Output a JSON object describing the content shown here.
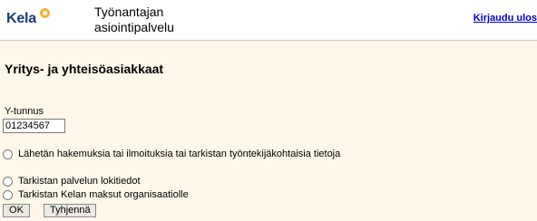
{
  "header": {
    "logo_text": "Kela",
    "service_line1": "Työnantajan",
    "service_line2": "asiointipalvelu",
    "logout_label": "Kirjaudu ulos"
  },
  "main": {
    "title": "Yritys- ja yhteisöasiakkaat",
    "ytunnus_label": "Y-tunnus",
    "ytunnus_value": "01234567",
    "options": [
      {
        "label": "Lähetän hakemuksia tai ilmoituksia tai tarkistan työntekijäkohtaisia tietoja",
        "selected": false
      },
      {
        "label": "Tarkistan palvelun lokitiedot",
        "selected": false
      },
      {
        "label": "Tarkistan Kelan maksut organisaatiolle",
        "selected": false
      }
    ],
    "ok_label": "OK",
    "clear_label": "Tyhjennä"
  },
  "colors": {
    "logo_blue": "#19397c",
    "logo_accent": "#f2b233",
    "link": "#0000cc",
    "page_background": "#fff8ea"
  }
}
